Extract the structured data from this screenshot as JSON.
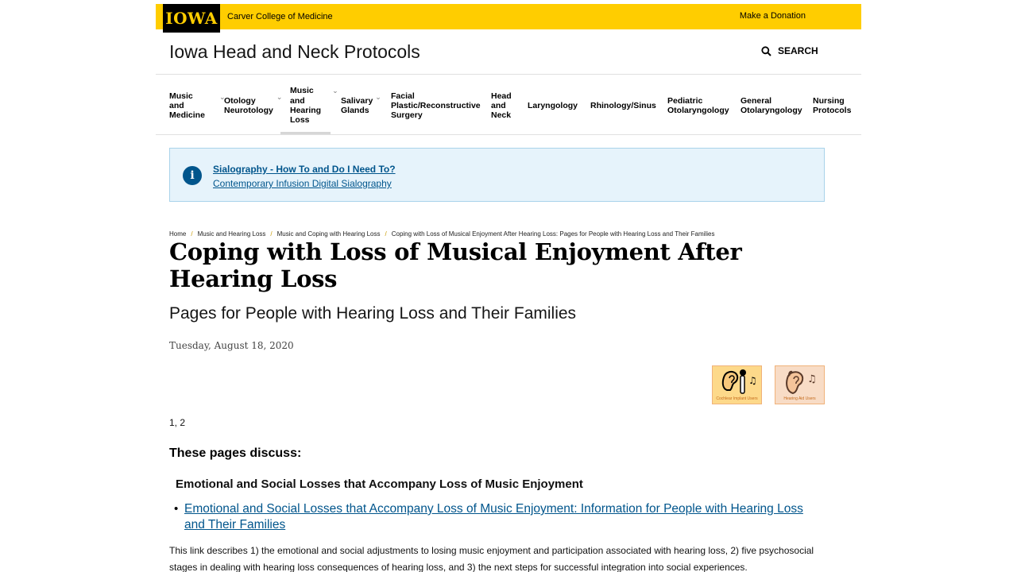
{
  "header": {
    "logo": "IOWA",
    "college": "Carver College of Medicine",
    "donate": "Make a Donation",
    "site_title": "Iowa Head and Neck Protocols",
    "search_label": "SEARCH"
  },
  "nav": [
    {
      "label": "Music\nand\nMedicine",
      "has_dropdown": true
    },
    {
      "label": "Otology\nNeurotology",
      "has_dropdown": true
    },
    {
      "label": "Music\nand\nHearing\nLoss",
      "has_dropdown": true,
      "active": true
    },
    {
      "label": "Salivary\nGlands",
      "has_dropdown": true
    },
    {
      "label": "Facial\nPlastic/Reconstructive\nSurgery",
      "has_dropdown": false
    },
    {
      "label": "Head\nand\nNeck",
      "has_dropdown": false
    },
    {
      "label": "Laryngology",
      "has_dropdown": false
    },
    {
      "label": "Rhinology/Sinus",
      "has_dropdown": false
    },
    {
      "label": "Pediatric\nOtolaryngology",
      "has_dropdown": false
    },
    {
      "label": "General\nOtolaryngology",
      "has_dropdown": false
    },
    {
      "label": "Nursing\nProtocols",
      "has_dropdown": false
    }
  ],
  "alert": {
    "icon": "info-icon",
    "link1": "Sialography - How To and Do I Need To?",
    "link2": "Contemporary Infusion Digital Sialography"
  },
  "breadcrumb": [
    "Home",
    "Music and Hearing Loss",
    "Music and Coping with Hearing Loss",
    "Coping with Loss of Musical Enjoyment After Hearing Loss: Pages for People with Hearing Loss and Their Families"
  ],
  "page": {
    "title": "Coping with Loss of Musical Enjoyment After Hearing Loss",
    "subtitle": "Pages for People with Hearing Loss and Their Families",
    "date": "Tuesday, August 18, 2020",
    "badges": [
      {
        "caption": "Cochlear Implant Users",
        "icon": "cochlear-implant-ear-icon"
      },
      {
        "caption": "Hearing Aid Users",
        "icon": "hearing-aid-ear-icon"
      }
    ],
    "refs": "1, 2",
    "discuss_heading": "These pages discuss:",
    "section_heading": "Emotional and Social Losses that Accompany Loss of Music Enjoyment",
    "main_link": "Emotional and Social Losses that Accompany Loss of Music Enjoyment: Information for People with Hearing Loss and Their Families",
    "body": "This link describes 1) the emotional and social adjustments to losing music enjoyment and participation associated with hearing loss, 2) five psychosocial stages in dealing with hearing loss consequences of hearing loss, and 3) the next steps for successful integration into social experiences."
  },
  "colors": {
    "gold": "#FFCD00",
    "link_blue": "#00558C",
    "alert_bg": "#e6f3fb"
  }
}
